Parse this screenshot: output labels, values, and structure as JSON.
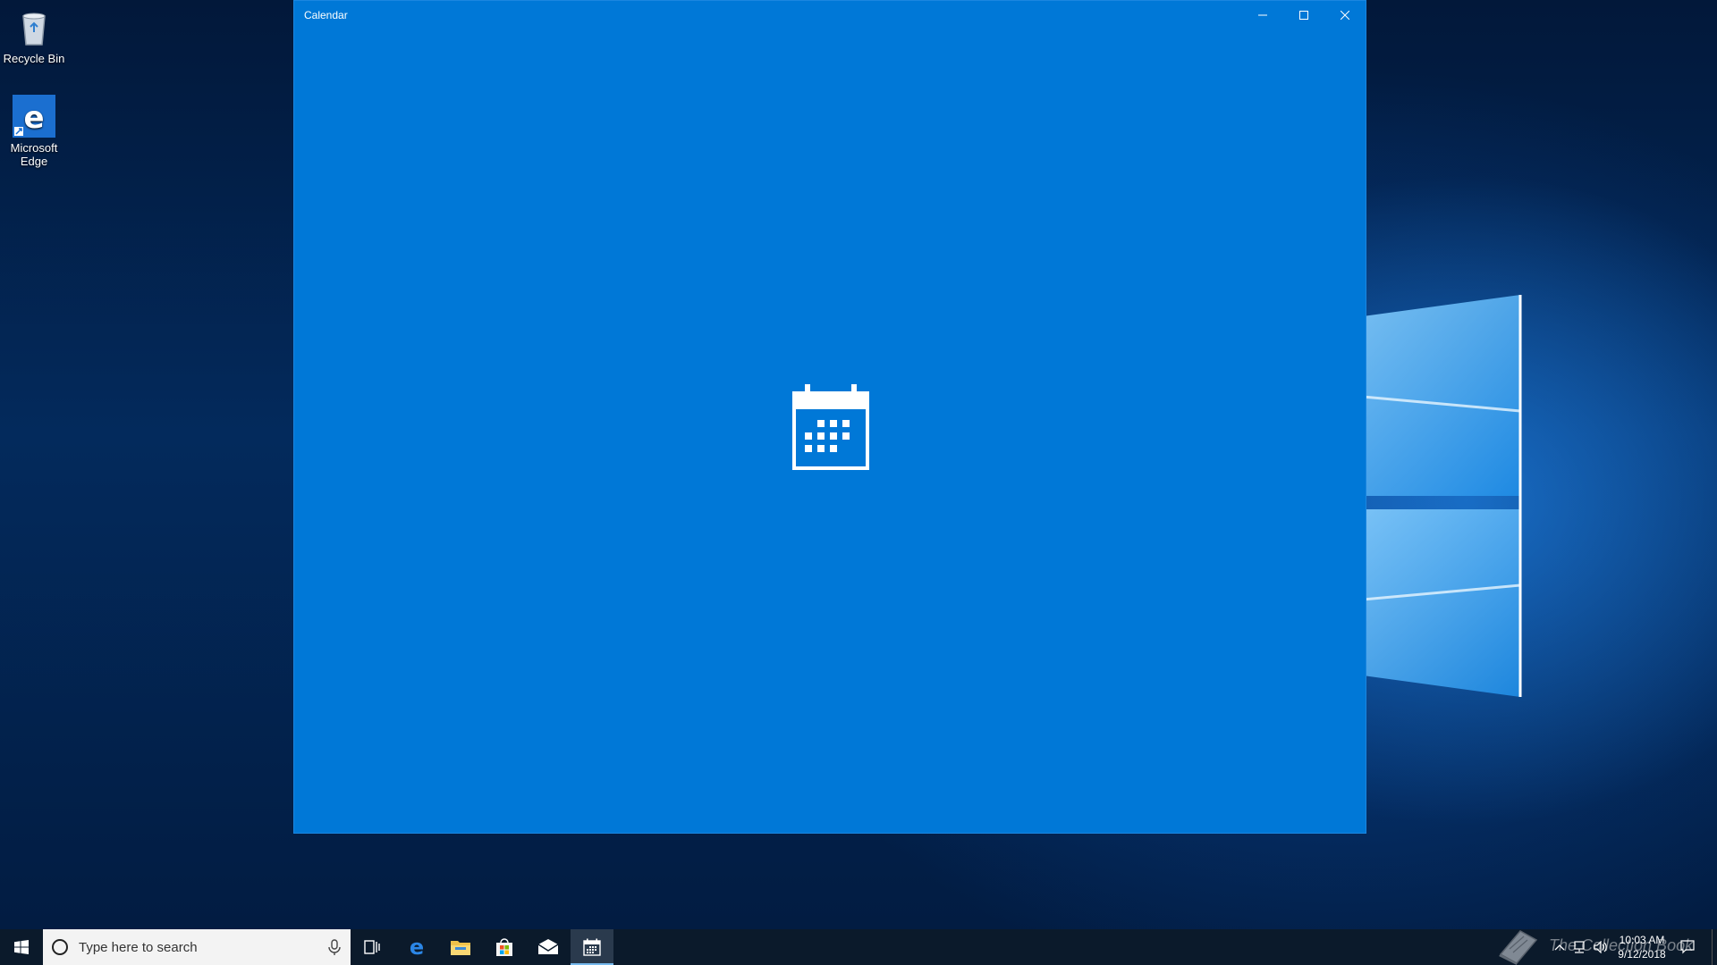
{
  "desktop": {
    "icons": [
      {
        "label": "Recycle Bin",
        "icon": "recycle-bin-icon"
      },
      {
        "label": "Microsoft Edge",
        "icon": "edge-icon"
      }
    ]
  },
  "window": {
    "title": "Calendar",
    "background_color": "#0078d7",
    "splash_icon": "calendar-icon",
    "controls": {
      "minimize": "minimize-icon",
      "maximize": "maximize-icon",
      "close": "close-icon"
    }
  },
  "taskbar": {
    "background_color": "#0b1a2b",
    "start": "windows-logo-icon",
    "search": {
      "placeholder": "Type here to search"
    },
    "pinned": [
      {
        "name": "Task View",
        "icon": "task-view-icon"
      },
      {
        "name": "Microsoft Edge",
        "icon": "edge-icon"
      },
      {
        "name": "File Explorer",
        "icon": "folder-icon"
      },
      {
        "name": "Microsoft Store",
        "icon": "store-icon"
      },
      {
        "name": "Mail",
        "icon": "mail-icon"
      },
      {
        "name": "Calendar",
        "icon": "calendar-icon",
        "active": true
      }
    ],
    "tray": {
      "time": "10:03 AM",
      "date": "9/12/2018"
    }
  },
  "watermark": {
    "text": "The Collection Book"
  }
}
